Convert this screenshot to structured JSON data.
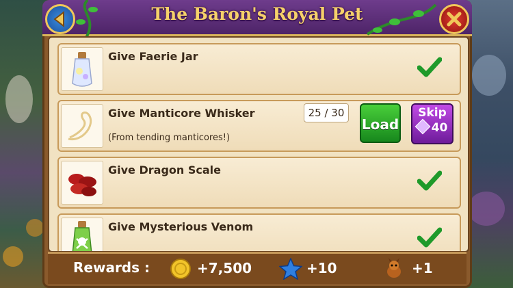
{
  "dialog": {
    "title": "The Baron's Royal Pet"
  },
  "tasks": [
    {
      "label": "Give Faerie Jar",
      "sub": "",
      "icon": "faerie-jar-icon",
      "status": "complete"
    },
    {
      "label": "Give Manticore Whisker",
      "sub": "(From tending manticores!)",
      "icon": "manticore-whisker-icon",
      "status": "in-progress",
      "progress": "25 / 30",
      "load_label": "Load",
      "skip_label": "Skip",
      "skip_cost": "40"
    },
    {
      "label": "Give Dragon Scale",
      "sub": "",
      "icon": "dragon-scale-icon",
      "status": "complete"
    },
    {
      "label": "Give Mysterious Venom",
      "sub": "",
      "icon": "mysterious-venom-icon",
      "status": "complete"
    }
  ],
  "rewards": {
    "label": "Rewards :",
    "coins": "+7,500",
    "xp": "+10",
    "item": "+1"
  },
  "colors": {
    "title_text": "#f6d16a",
    "title_bar": "#5a2a78",
    "check_green": "#1f9a2a",
    "load_green": "#2aa52c",
    "skip_purple": "#9b33c8"
  }
}
